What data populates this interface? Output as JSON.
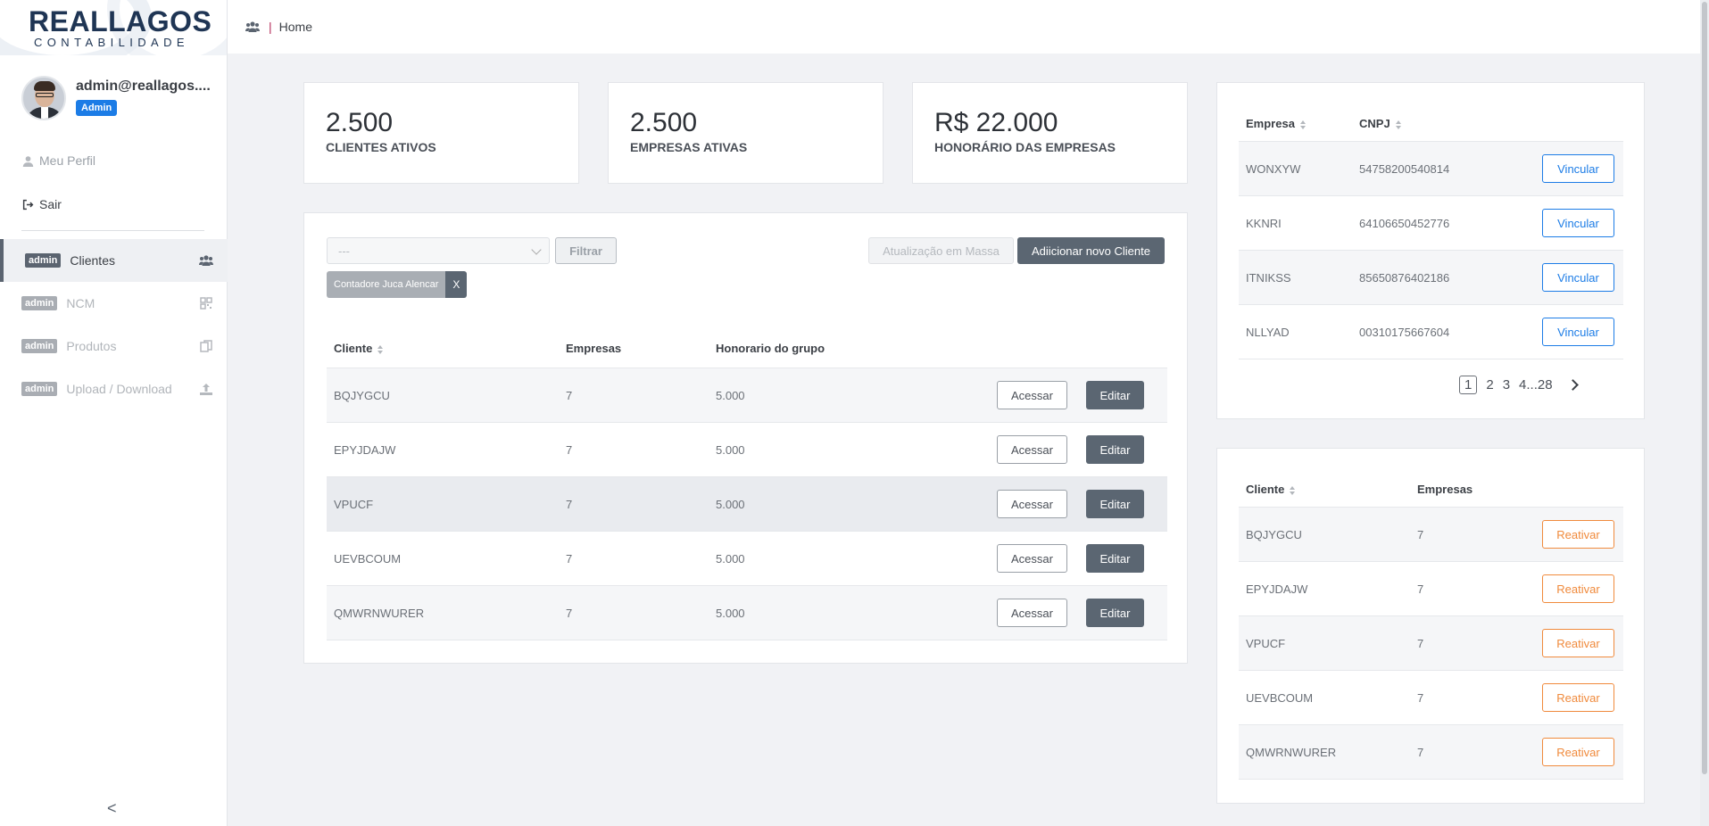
{
  "brand": {
    "name": "REALLAGOS",
    "sub": "CONTABILIDADE"
  },
  "user": {
    "email": "admin@reallagos....",
    "role": "Admin"
  },
  "side_links": {
    "perfil": "Meu Perfil",
    "sair": "Sair"
  },
  "nav": [
    {
      "tag": "admin",
      "label": "Clientes",
      "active": true,
      "icon": "users-icon"
    },
    {
      "tag": "admin",
      "label": "NCM",
      "active": false,
      "icon": "qrcode-icon"
    },
    {
      "tag": "admin",
      "label": "Produtos",
      "active": false,
      "icon": "copy-icon"
    },
    {
      "tag": "admin",
      "label": "Upload / Download",
      "active": false,
      "icon": "upload-icon"
    }
  ],
  "collapse": "<",
  "breadcrumb": {
    "sep": "|",
    "label": "Home"
  },
  "stats": [
    {
      "value": "2.500",
      "label": "CLIENTES ATIVOS"
    },
    {
      "value": "2.500",
      "label": "EMPRESAS ATIVAS"
    },
    {
      "value": "R$ 22.000",
      "label": "HONORÁRIO DAS EMPRESAS"
    }
  ],
  "filters": {
    "select_value": "---",
    "filter_label": "Filtrar",
    "mass_update_label": "Atualização em Massa",
    "add_label": "Adiicionar novo Cliente",
    "chip_label": "Contadore Juca Alencar",
    "chip_close": "X"
  },
  "clients_table": {
    "headers": [
      "Cliente",
      "Empresas",
      "Honorario do grupo"
    ],
    "access_label": "Acessar",
    "edit_label": "Editar",
    "rows": [
      {
        "cliente": "BQJYGCU",
        "empresas": "7",
        "honorario": "5.000"
      },
      {
        "cliente": "EPYJDAJW",
        "empresas": "7",
        "honorario": "5.000"
      },
      {
        "cliente": "VPUCF",
        "empresas": "7",
        "honorario": "5.000"
      },
      {
        "cliente": "UEVBCOUM",
        "empresas": "7",
        "honorario": "5.000"
      },
      {
        "cliente": "QMWRNWURER",
        "empresas": "7",
        "honorario": "5.000"
      }
    ]
  },
  "companies_table": {
    "headers": [
      "Empresa",
      "CNPJ"
    ],
    "action_label": "Vincular",
    "rows": [
      {
        "empresa": "WONXYW",
        "cnpj": "54758200540814"
      },
      {
        "empresa": "KKNRI",
        "cnpj": "64106650452776"
      },
      {
        "empresa": "ITNIKSS",
        "cnpj": "85650876402186"
      },
      {
        "empresa": "NLLYAD",
        "cnpj": "00310175667604"
      }
    ],
    "pagination": [
      "1",
      "2",
      "3",
      "4",
      "...28"
    ]
  },
  "inactive_table": {
    "headers": [
      "Cliente",
      "Empresas"
    ],
    "action_label": "Reativar",
    "rows": [
      {
        "cliente": "BQJYGCU",
        "empresas": "7"
      },
      {
        "cliente": "EPYJDAJW",
        "empresas": "7"
      },
      {
        "cliente": "VPUCF",
        "empresas": "7"
      },
      {
        "cliente": "UEVBCOUM",
        "empresas": "7"
      },
      {
        "cliente": "QMWRNWURER",
        "empresas": "7"
      }
    ]
  }
}
